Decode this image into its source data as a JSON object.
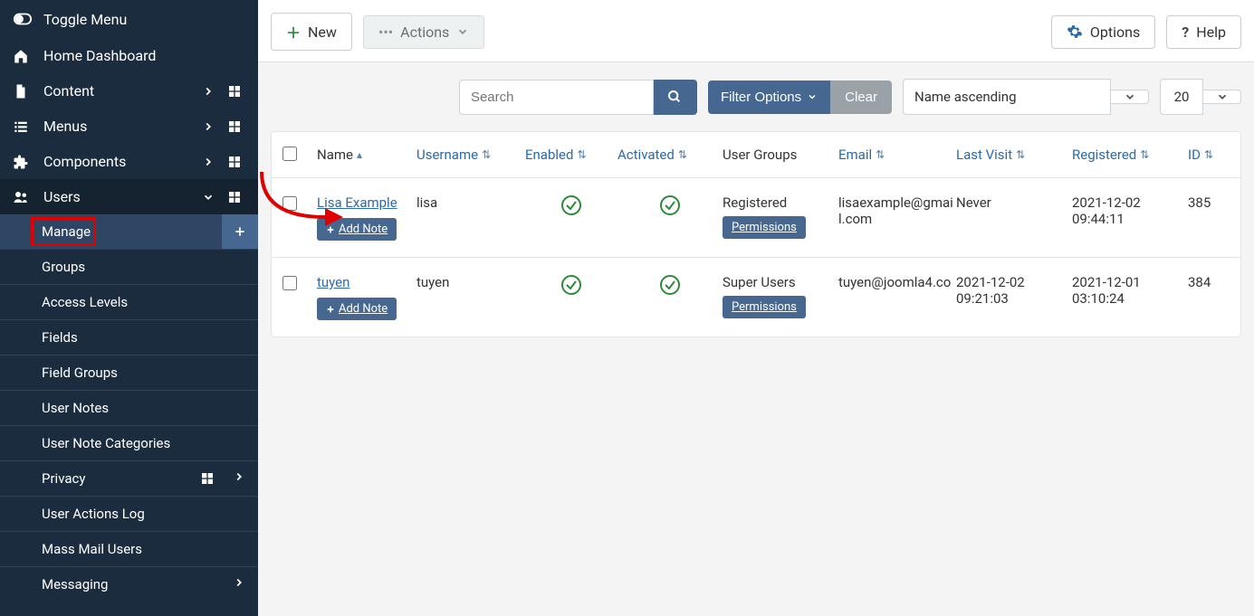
{
  "sidebar": {
    "toggle_label": "Toggle Menu",
    "items": [
      {
        "label": "Home Dashboard",
        "icon": "home"
      },
      {
        "label": "Content",
        "icon": "file",
        "chevron": "right",
        "grid": true
      },
      {
        "label": "Menus",
        "icon": "list",
        "chevron": "right",
        "grid": true
      },
      {
        "label": "Components",
        "icon": "puzzle",
        "chevron": "right",
        "grid": true
      },
      {
        "label": "Users",
        "icon": "users",
        "chevron": "down",
        "grid": true,
        "expanded": true
      }
    ],
    "sub": [
      {
        "label": "Manage",
        "active": true,
        "plus": true,
        "highlighted": true
      },
      {
        "label": "Groups"
      },
      {
        "label": "Access Levels"
      },
      {
        "label": "Fields"
      },
      {
        "label": "Field Groups"
      },
      {
        "label": "User Notes"
      },
      {
        "label": "User Note Categories"
      },
      {
        "label": "Privacy",
        "chevron": "right",
        "grid": true
      },
      {
        "label": "User Actions Log"
      },
      {
        "label": "Mass Mail Users"
      },
      {
        "label": "Messaging",
        "chevron": "right"
      }
    ]
  },
  "toolbar": {
    "new_label": "New",
    "actions_label": "Actions",
    "options_label": "Options",
    "help_label": "Help"
  },
  "filters": {
    "search_placeholder": "Search",
    "filter_options_label": "Filter Options",
    "clear_label": "Clear",
    "sort_value": "Name ascending",
    "limit_value": "20"
  },
  "table": {
    "headers": {
      "name": "Name",
      "username": "Username",
      "enabled": "Enabled",
      "activated": "Activated",
      "groups": "User Groups",
      "email": "Email",
      "last_visit": "Last Visit",
      "registered": "Registered",
      "id": "ID"
    },
    "add_note_label": "Add Note",
    "permissions_label": "Permissions",
    "rows": [
      {
        "name": "Lisa Example",
        "username": "lisa",
        "enabled": true,
        "activated": true,
        "group": "Registered",
        "email": "lisaexample@gmail.com",
        "last_visit": "Never",
        "registered": "2021-12-02 09:44:11",
        "id": "385"
      },
      {
        "name": "tuyen",
        "username": "tuyen",
        "enabled": true,
        "activated": true,
        "group": "Super Users",
        "email": "tuyen@joomla4.co",
        "last_visit": "2021-12-02 09:21:03",
        "registered": "2021-12-01 03:10:24",
        "id": "384"
      }
    ]
  }
}
